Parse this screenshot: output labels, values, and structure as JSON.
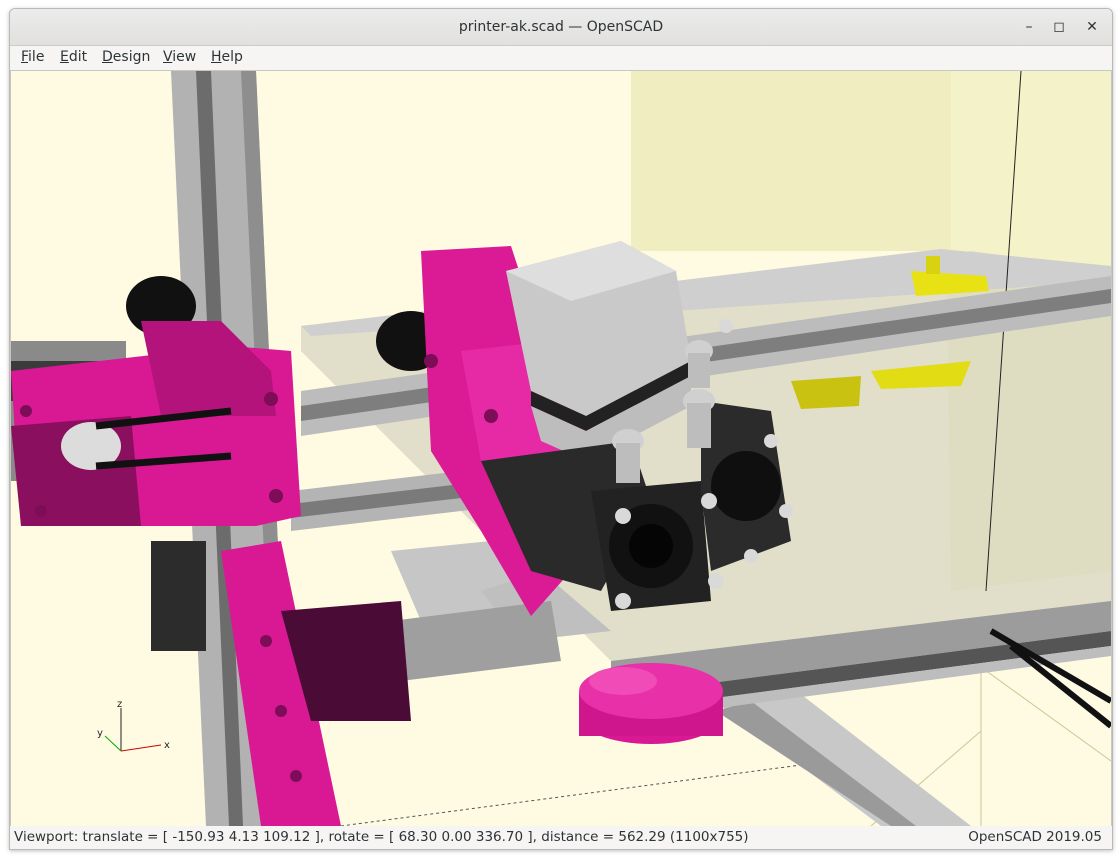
{
  "window": {
    "title": "printer-ak.scad — OpenSCAD",
    "controls": {
      "minimize": "–",
      "maximize": "◻",
      "close": "✕"
    }
  },
  "menubar": {
    "items": [
      {
        "label_ul": "F",
        "label_rest": "ile"
      },
      {
        "label_ul": "E",
        "label_rest": "dit"
      },
      {
        "label_ul": "D",
        "label_rest": "esign"
      },
      {
        "label_ul": "V",
        "label_rest": "iew"
      },
      {
        "label_ul": "H",
        "label_rest": "elp"
      }
    ]
  },
  "viewport": {
    "axis_labels": {
      "x": "x",
      "y": "y",
      "z": "z"
    },
    "colors": {
      "background": "#fefbe2",
      "printed_parts": "#e0199a",
      "extrusion": "#a8a8a8",
      "fan": "#1e1e1e",
      "accent_yellow": "#e8e214"
    }
  },
  "statusbar": {
    "viewport_info": "Viewport: translate = [ -150.93 4.13 109.12 ], rotate = [ 68.30 0.00 336.70 ], distance = 562.29 (1100x755)",
    "version": "OpenSCAD 2019.05"
  }
}
